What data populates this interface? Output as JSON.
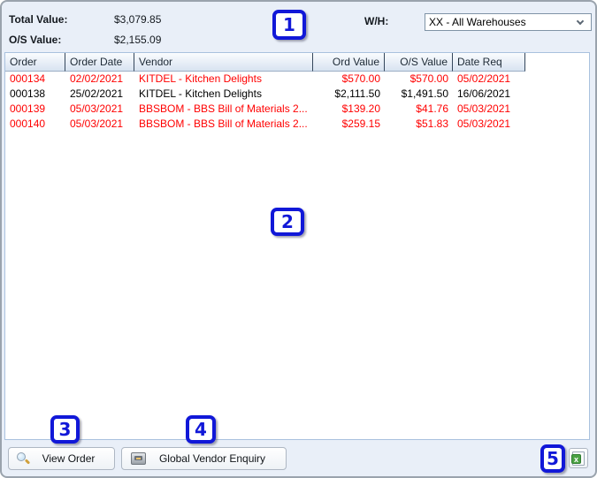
{
  "summary": {
    "total_label": "Total Value:",
    "total_value": "$3,079.85",
    "os_label": "O/S Value:",
    "os_value": "$2,155.09",
    "wh_label": "W/H:",
    "wh_selected": "XX - All Warehouses"
  },
  "table": {
    "columns": [
      "Order",
      "Order Date",
      "Vendor",
      "Ord Value",
      "O/S Value",
      "Date Req"
    ],
    "rows": [
      {
        "order": "000134",
        "date": "02/02/2021",
        "vendor": "KITDEL - Kitchen Delights",
        "ord": "$570.00",
        "os": "$570.00",
        "req": "05/02/2021",
        "alert": true
      },
      {
        "order": "000138",
        "date": "25/02/2021",
        "vendor": "KITDEL - Kitchen Delights",
        "ord": "$2,111.50",
        "os": "$1,491.50",
        "req": "16/06/2021",
        "alert": false
      },
      {
        "order": "000139",
        "date": "05/03/2021",
        "vendor": "BBSBOM - BBS Bill of Materials 2...",
        "ord": "$139.20",
        "os": "$41.76",
        "req": "05/03/2021",
        "alert": true
      },
      {
        "order": "000140",
        "date": "05/03/2021",
        "vendor": "BBSBOM - BBS Bill of Materials 2...",
        "ord": "$259.15",
        "os": "$51.83",
        "req": "05/03/2021",
        "alert": true
      }
    ]
  },
  "toolbar": {
    "view_order_label": "View Order",
    "global_vendor_label": "Global Vendor Enquiry",
    "excel_glyph": "x"
  },
  "icons": {
    "view_order": "magnifier-icon",
    "global_vendor": "cash-register-icon",
    "export": "excel-export-icon",
    "wh_dropdown": "chevron-down-icon"
  },
  "annotations": [
    "1",
    "2",
    "3",
    "4",
    "5"
  ],
  "colors": {
    "alert_row": "#ff0000",
    "annotation_blue": "#1118d8",
    "window_background": "#e9eff8",
    "table_border": "#a9c1de",
    "excel_green": "#4ba243"
  }
}
